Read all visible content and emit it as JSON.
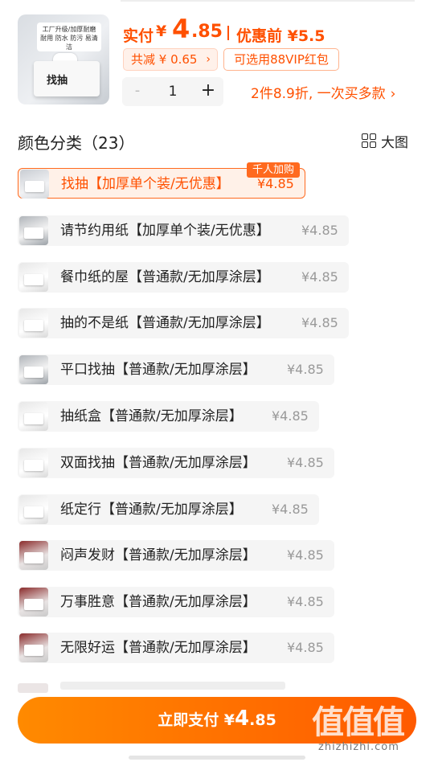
{
  "product": {
    "thumb_text": "工厂升级/加厚耐磨 耐用 防水 防污 易清洁",
    "thumb_box_label": "找抽",
    "price_label": "实付",
    "currency": "¥",
    "price_int": "4",
    "price_dec": ".85",
    "price_before": "优惠前 ¥5.5",
    "discount_chip": "共减 ¥ 0.65",
    "vip_chip": "可选用88VIP红包",
    "quantity": "1",
    "minus_symbol": "-",
    "plus_symbol": "+",
    "promo_text": "2件8.9折, 一次买多款",
    "chevron": "›"
  },
  "section": {
    "title": "颜色分类（23）",
    "view_label": "大图"
  },
  "variants": [
    {
      "name": "找抽【加厚单个装/无优惠】",
      "price": "¥4.85",
      "tag": "千人加购",
      "selected": true
    },
    {
      "name": "请节约用纸【加厚单个装/无优惠】",
      "price": "¥4.85"
    },
    {
      "name": "餐巾纸的屋【普通款/无加厚涂层】",
      "price": "¥4.85"
    },
    {
      "name": "抽的不是纸【普通款/无加厚涂层】",
      "price": "¥4.85"
    },
    {
      "name": "平口找抽【普通款/无加厚涂层】",
      "price": "¥4.85"
    },
    {
      "name": "抽纸盒【普通款/无加厚涂层】",
      "price": "¥4.85"
    },
    {
      "name": "双面找抽【普通款/无加厚涂层】",
      "price": "¥4.85"
    },
    {
      "name": "纸定行【普通款/无加厚涂层】",
      "price": "¥4.85"
    },
    {
      "name": "闷声发财【普通款/无加厚涂层】",
      "price": "¥4.85"
    },
    {
      "name": "万事胜意【普通款/无加厚涂层】",
      "price": "¥4.85"
    },
    {
      "name": "无限好运【普通款/无加厚涂层】",
      "price": "¥4.85"
    }
  ],
  "footer": {
    "pay_label": "立即支付 ¥",
    "pay_int": "4",
    "pay_dec": ".85",
    "watermark_big": "值值值",
    "watermark_small": "zhizhizhi.com"
  },
  "colors": {
    "accent": "#ff5000",
    "selected_bg": "#fff1e8",
    "row_bg": "#f5f5f5",
    "muted_price": "#999999"
  },
  "icons": {
    "view_toggle": "grid-icon"
  }
}
